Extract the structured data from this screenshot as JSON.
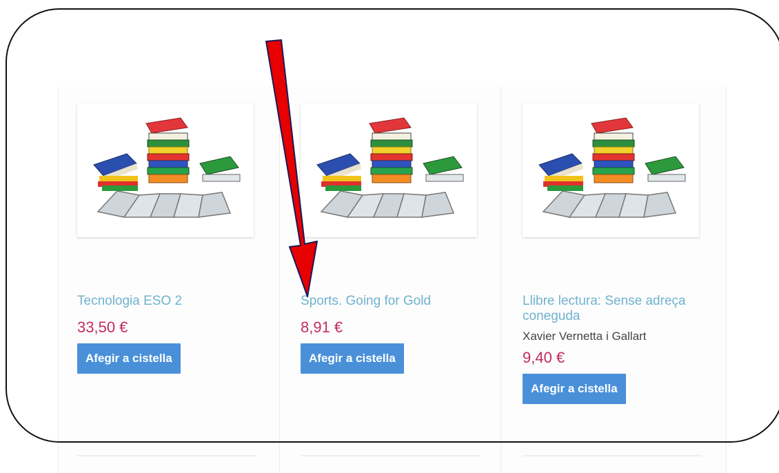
{
  "products": [
    {
      "title": "Tecnologia ESO 2",
      "price": "33,50 €",
      "author": "",
      "button": "Afegir a cistella"
    },
    {
      "title": "Sports. Going for Gold",
      "price": "8,91 €",
      "author": "",
      "button": "Afegir a cistella"
    },
    {
      "title": "Llibre lectura: Sense adreça coneguda",
      "price": "9,40 €",
      "author": "Xavier Vernetta i Gallart",
      "button": "Afegir a cistella"
    }
  ],
  "colors": {
    "title": "#6fb2cf",
    "price": "#c42b5a",
    "button": "#4a90d9",
    "annotation_arrow": "#e60000"
  },
  "icons": [
    "book-stack-icon"
  ]
}
